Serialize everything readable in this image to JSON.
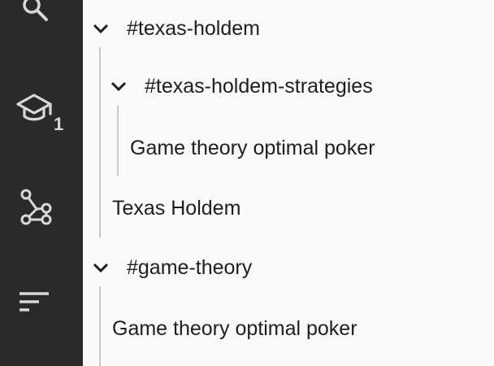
{
  "sidebar": {
    "items": [
      {
        "icon": "search-icon"
      },
      {
        "icon": "graduation-cap-icon",
        "badge": "1"
      },
      {
        "icon": "graph-icon"
      },
      {
        "icon": "sort-icon"
      }
    ]
  },
  "tree": {
    "texas_holdem": {
      "label": "#texas-holdem",
      "children": {
        "strategies": {
          "label": "#texas-holdem-strategies",
          "notes": [
            "Game theory optimal poker"
          ]
        },
        "notes": [
          "Texas Holdem"
        ]
      }
    },
    "game_theory": {
      "label": "#game-theory",
      "notes": [
        "Game theory optimal poker"
      ]
    }
  },
  "colors": {
    "sidebar_bg": "#2a2a2a",
    "icon": "#d8d8d8",
    "content_bg": "#fafafa",
    "text": "#1e1e1e",
    "guide": "#c9c9c9"
  }
}
